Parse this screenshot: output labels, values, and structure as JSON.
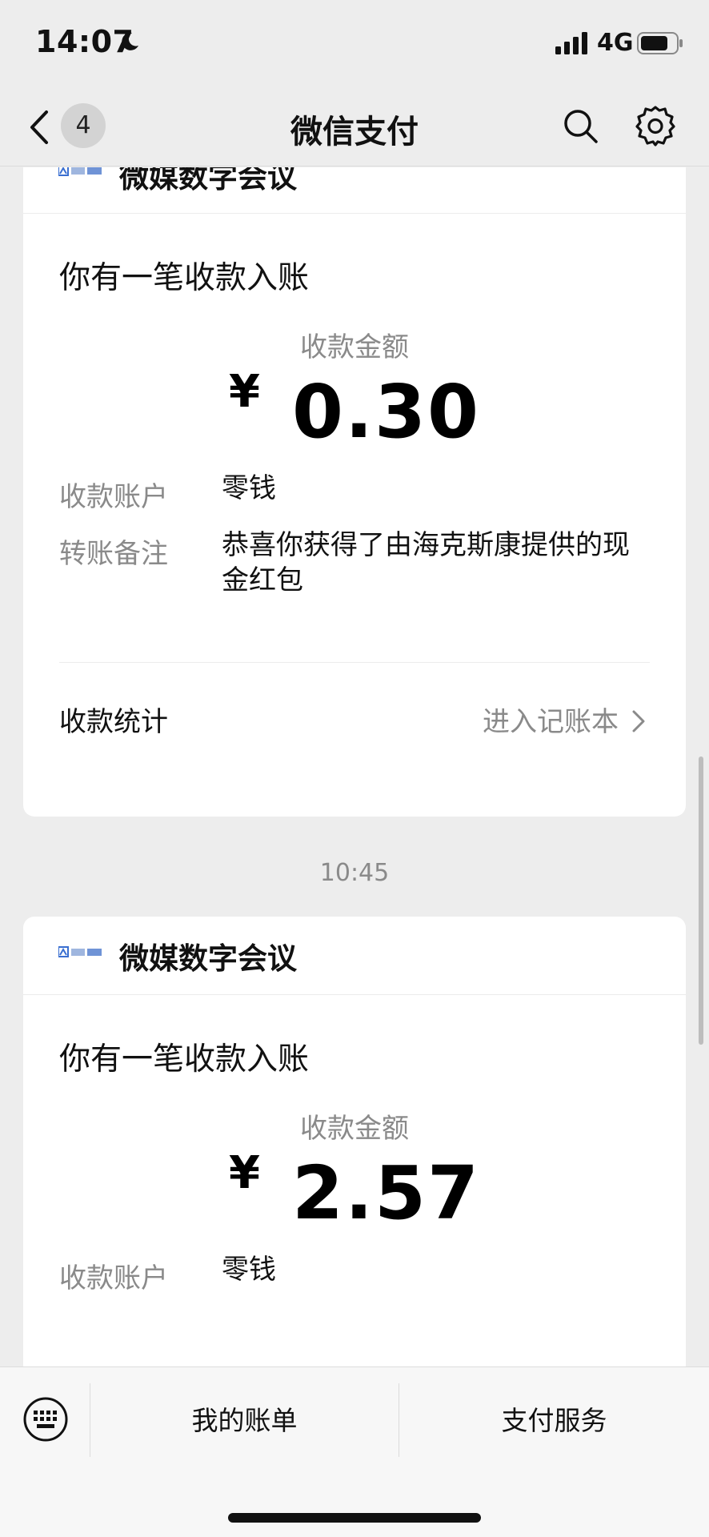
{
  "status_bar": {
    "time": "14:07",
    "network": "4G"
  },
  "nav": {
    "unread_count": "4",
    "title": "微信支付"
  },
  "cards": [
    {
      "brand": "微媒数字会议",
      "title": "你有一笔收款入账",
      "amount_label": "收款金额",
      "currency": "¥",
      "amount": "0.30",
      "account_label": "收款账户",
      "account_value": "零钱",
      "note_label": "转账备注",
      "note_value": "恭喜你获得了由海克斯康提供的现金红包",
      "stats_label": "收款统计",
      "stats_link": "进入记账本"
    },
    {
      "brand": "微媒数字会议",
      "title": "你有一笔收款入账",
      "amount_label": "收款金额",
      "currency": "¥",
      "amount": "2.57",
      "account_label": "收款账户",
      "account_value": "零钱"
    }
  ],
  "timestamp": "10:45",
  "bottom_bar": {
    "item1": "我的账单",
    "item2": "支付服务"
  }
}
